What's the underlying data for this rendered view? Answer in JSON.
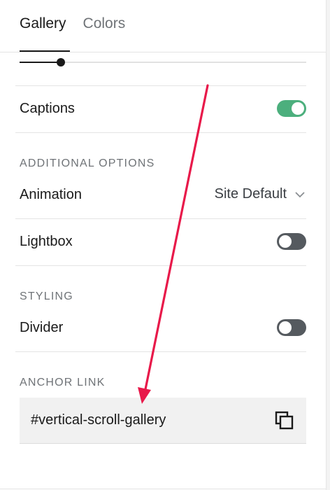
{
  "tabs": [
    {
      "label": "Gallery"
    },
    {
      "label": "Colors"
    }
  ],
  "slider": {
    "value": 0.145
  },
  "captions": {
    "label": "Captions",
    "enabled": true
  },
  "additional_options": {
    "section_label": "ADDITIONAL OPTIONS",
    "animation": {
      "label": "Animation",
      "value": "Site Default"
    },
    "lightbox": {
      "label": "Lightbox",
      "enabled": false
    }
  },
  "styling": {
    "section_label": "STYLING",
    "divider": {
      "label": "Divider",
      "enabled": false
    }
  },
  "anchor_link": {
    "section_label": "ANCHOR LINK",
    "value": "#vertical-scroll-gallery"
  },
  "colors": {
    "toggle_on": "#4caf7d",
    "toggle_off": "#555a5f",
    "annotation_arrow": "#e8194a"
  },
  "icons": {
    "chevron": "chevron-down-icon",
    "copy": "copy-icon"
  }
}
